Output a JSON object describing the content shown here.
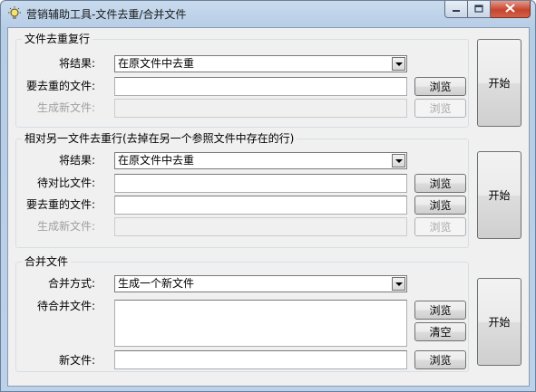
{
  "window": {
    "title": "营销辅助工具-文件去重/合并文件"
  },
  "section1": {
    "title": "文件去重复行",
    "result_label": "将结果:",
    "result_value": "在原文件中去重",
    "dedup_file_label": "要去重的文件:",
    "dedup_file_value": "",
    "new_file_label": "生成新文件:",
    "new_file_value": "",
    "browse1": "浏览",
    "browse2": "浏览",
    "start": "开始"
  },
  "section2": {
    "title": "相对另一文件去重行(去掉在另一个参照文件中存在的行)",
    "result_label": "将结果:",
    "result_value": "在原文件中去重",
    "compare_file_label": "待对比文件:",
    "compare_file_value": "",
    "dedup_file_label": "要去重的文件:",
    "dedup_file_value": "",
    "new_file_label": "生成新文件:",
    "new_file_value": "",
    "browse1": "浏览",
    "browse2": "浏览",
    "browse3": "浏览",
    "start": "开始"
  },
  "section3": {
    "title": "合并文件",
    "mode_label": "合并方式:",
    "mode_value": "生成一个新文件",
    "merge_files_label": "待合并文件:",
    "merge_files_value": "",
    "new_file_label": "新文件:",
    "new_file_value": "",
    "browse1": "浏览",
    "clear": "清空",
    "browse2": "浏览",
    "start": "开始"
  },
  "icons": {
    "app": "lightbulb-icon",
    "minimize": "minimize-icon",
    "maximize": "maximize-icon",
    "close": "close-icon"
  }
}
